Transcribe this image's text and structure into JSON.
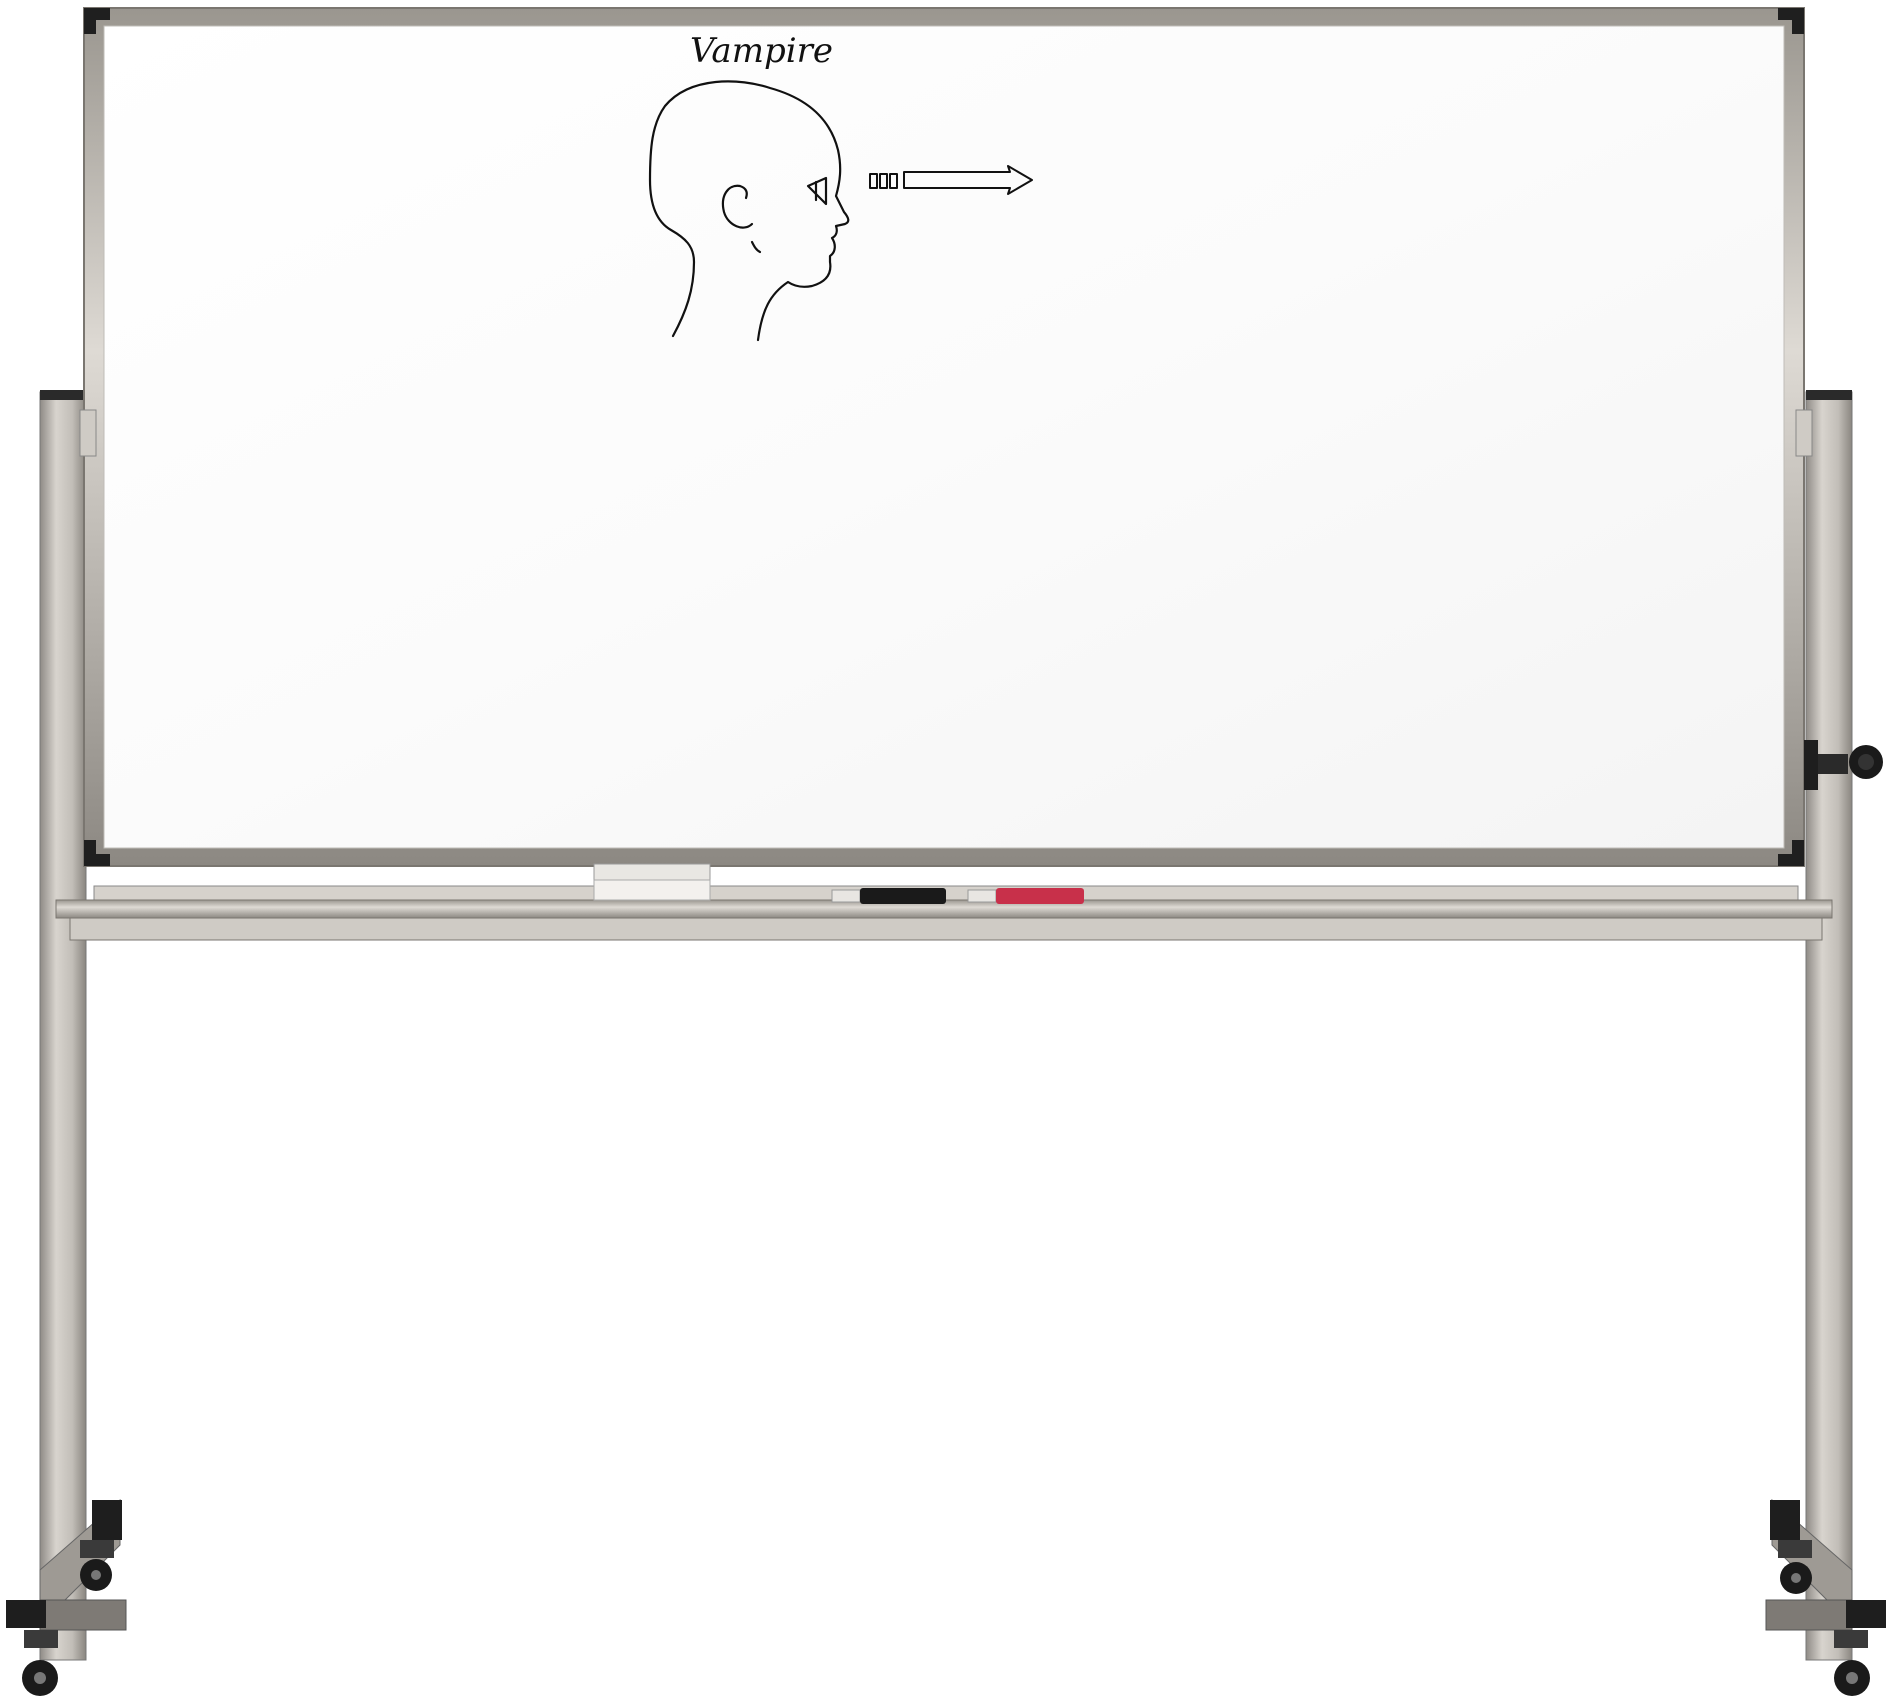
{
  "whiteboard": {
    "heading": "Vampire",
    "drawing": "head-profile-with-gaze-arrow"
  },
  "tray_items": [
    "eraser",
    "black-marker",
    "red-marker"
  ],
  "colors": {
    "frame": "#c9c5bf",
    "frame_edge": "#8f8b86",
    "board": "#ffffff",
    "corner_caps": "#1f1f1f",
    "ink": "#111111",
    "red_marker": "#c8304a",
    "black_marker": "#1a1a1a"
  }
}
